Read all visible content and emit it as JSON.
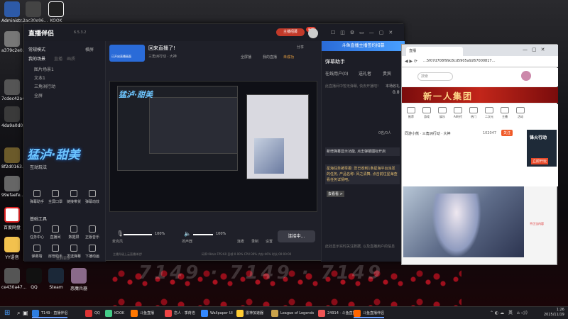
{
  "desktop": {
    "left_icons": [
      {
        "label": "Administr..."
      },
      {
        "label": "2ac30e96..."
      },
      {
        "label": "a379c2e0..."
      },
      {
        "label": "7cdec42a4..."
      },
      {
        "label": "4da9a0d0..."
      },
      {
        "label": "8f2d0163..."
      },
      {
        "label": "99efaefe..."
      },
      {
        "label": "百度网盘"
      },
      {
        "label": "YY语音"
      },
      {
        "label": "ce430a47..."
      }
    ],
    "bottom_icons": [
      {
        "label": "QQ"
      },
      {
        "label": "Steam"
      },
      {
        "label": "恶魔兵器"
      }
    ],
    "top_icon_label": "KOOK",
    "watermark": "7149 · 7149 · 7149",
    "colors": {
      "flower": "#c01222",
      "bg": "#141418"
    }
  },
  "app": {
    "name": "直播伴侣",
    "version": "6.5.3.2",
    "stream_title": "回来直播了!",
    "category": "三角洲行动 · 大神",
    "share": "分享",
    "home_button": "主播招募",
    "badge": "新版",
    "toolbar_items": [
      "全屏播",
      "我的直播",
      "未成功"
    ],
    "mode": "常规模式",
    "mode_right": "横屏",
    "scenes_header": "我的场景",
    "scenes_tabs": [
      "直播",
      "画质"
    ],
    "scenes": [
      "图片场景1",
      "文本1",
      "三角洲行动",
      "全屏"
    ],
    "scene_thumb": "已开启直播画面",
    "sidebar_banner": "猛泸·甜美",
    "interact_header": "互动玩法",
    "interact": [
      "弹幕助手",
      "全屏口罩",
      "链接带货",
      "弹幕动效"
    ],
    "interact_top": [
      "",
      "",
      "",
      ""
    ],
    "tools_header": "基础工具",
    "tools": [
      "任务中心",
      "直播间",
      "数据屏",
      "正版音乐",
      "弹幕墙",
      "房管助手",
      "发送弹幕",
      "下播动画"
    ],
    "more": "玩转更多",
    "mic_label": "麦克风",
    "mic_value": "100%",
    "speaker_label": "扬声器",
    "speaker_value": "100%",
    "buttons": [
      "连麦",
      "录制",
      "设置"
    ],
    "start_button": "连接中...",
    "footer": "码率:0kb/s  FPS:60  丢帧:0.00%  CPU:30%  内存:46%  时长:00:00:00",
    "upgrade_hint": "主播升级上云直播体验!"
  },
  "right_panel": {
    "banner": "斗鱼直播主播签约招募",
    "title": "弹幕助手",
    "tabs": [
      "在线用户(0)",
      "送礼者",
      "贵宾"
    ],
    "notice": "此直播间中暂无弹幕, 快去开播吧!",
    "stats_label": "本场收礼",
    "stats_value": "0.0",
    "count": "0名/0人",
    "msg1": "新增弹幕显示功能, 点击弹幕图标开启",
    "msg2": "星海任务被举报: 您已收到1条星海平台派发的任务, 产品名称: 风之清舞, 点击前往星海查看任务详情吧。",
    "link": "去看看 >",
    "bottom_hint": "此处显示实时关注数据, 以及直播用户的信息"
  },
  "browser": {
    "tab1": "直播",
    "address": "…5f07d708f99c8cd5905a9267000817…",
    "search_placeholder": "搜索",
    "banner": "新一人集团",
    "nav": [
      "推荐",
      "游戏",
      "娱乐",
      "AI时代",
      "热门",
      "二次元",
      "主播",
      "活动",
      "用户"
    ],
    "room_title": "同游小熊 · 三角洲行动 · 大神",
    "fans": "102047",
    "btn": "关注",
    "right_label1": "锋火行动",
    "right_label2": "立即开玩",
    "right_label3": "不正当内容"
  },
  "taskbar": {
    "items": [
      "T149 · 直播伴侣",
      "QQ",
      "KOOK",
      "斗鱼直播",
      "恋人 · 季荷浩",
      "Wallpaper UI",
      "雷神加速器",
      "League of Legends",
      "24914 · 斗鱼直播",
      "斗鱼直播伴侣"
    ],
    "lang": "英",
    "time": "1:26",
    "date": "2025/11/19"
  }
}
